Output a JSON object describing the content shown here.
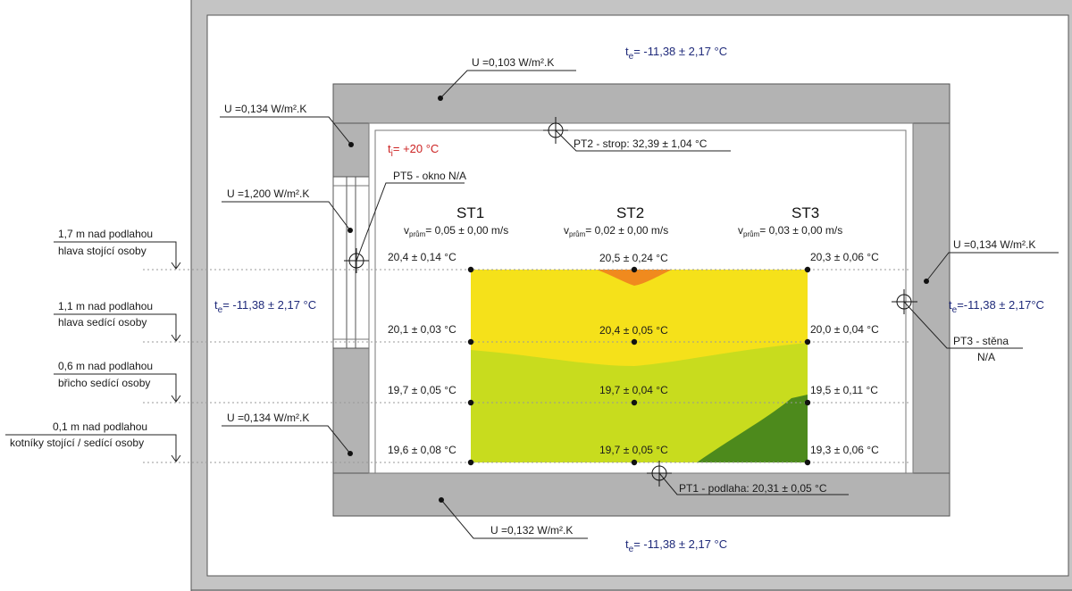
{
  "ambient_outside": {
    "top": "t",
    "top_sub": "e",
    "top_value": "= -11,38 ± 2,17 °C",
    "left_value": "= -11,38 ± 2,17 °C",
    "right_value": "=-11,38 ± 2,17°C",
    "bottom_value": "= -11,38 ± 2,17 °C"
  },
  "ambient_inside": {
    "t": "t",
    "sub": "i",
    "value": "= +20 °C"
  },
  "u_labels": {
    "roof": "U =0,103 W/m².K",
    "left_top": "U =0,134 W/m².K",
    "window": "U =1,200 W/m².K",
    "left_bottom": "U =0,134 W/m².K",
    "floor": "U =0,132 W/m².K",
    "right": "U =0,134 W/m².K"
  },
  "probes": {
    "pt1": "PT1 - podlaha: 20,31 ± 0,05 °C",
    "pt2": "PT2 - strop: 32,39 ± 1,04 °C",
    "pt3_line1": "PT3 - stěna",
    "pt3_line2": "N/A",
    "pt5": "PT5 - okno N/A"
  },
  "heights": [
    {
      "l1": "1,7 m nad podlahou",
      "l2": "hlava stojící osoby"
    },
    {
      "l1": "1,1 m nad podlahou",
      "l2": "hlava sedící osoby"
    },
    {
      "l1": "0,6 m nad podlahou",
      "l2": "břicho sedící osoby"
    },
    {
      "l1": "0,1 m nad podlahou",
      "l2": "kotníky stojící / sedící osoby"
    }
  ],
  "stations": [
    {
      "name": "ST1",
      "v": "v",
      "v_sub": "prům",
      "v_value": "= 0,05 ± 0,00 m/s"
    },
    {
      "name": "ST2",
      "v": "v",
      "v_sub": "prům",
      "v_value": "= 0,02 ± 0,00 m/s"
    },
    {
      "name": "ST3",
      "v": "v",
      "v_sub": "prům",
      "v_value": "= 0,03 ± 0,00 m/s"
    }
  ],
  "grid_temps": {
    "st1": [
      "20,4 ± 0,14 °C",
      "20,1 ± 0,03 °C",
      "19,7 ± 0,05 °C",
      "19,6 ± 0,08 °C"
    ],
    "st2": [
      "20,5 ± 0,24 °C",
      "20,4 ± 0,05 °C",
      "19,7 ± 0,04 °C",
      "19,7 ± 0,05 °C"
    ],
    "st3": [
      "20,3 ± 0,06 °C",
      "20,0 ± 0,04 °C",
      "19,5 ± 0,11 °C",
      "19,3 ± 0,06 °C"
    ]
  },
  "colors": {
    "wall": "#b3b3b3",
    "frame": "#c4c4c4",
    "orange": "#f08a1e",
    "yellow": "#f5e11a",
    "lime": "#c8dc1e",
    "green": "#4d8a1c",
    "label_blue": "#1f2a7a",
    "label_red": "#cc2222"
  }
}
